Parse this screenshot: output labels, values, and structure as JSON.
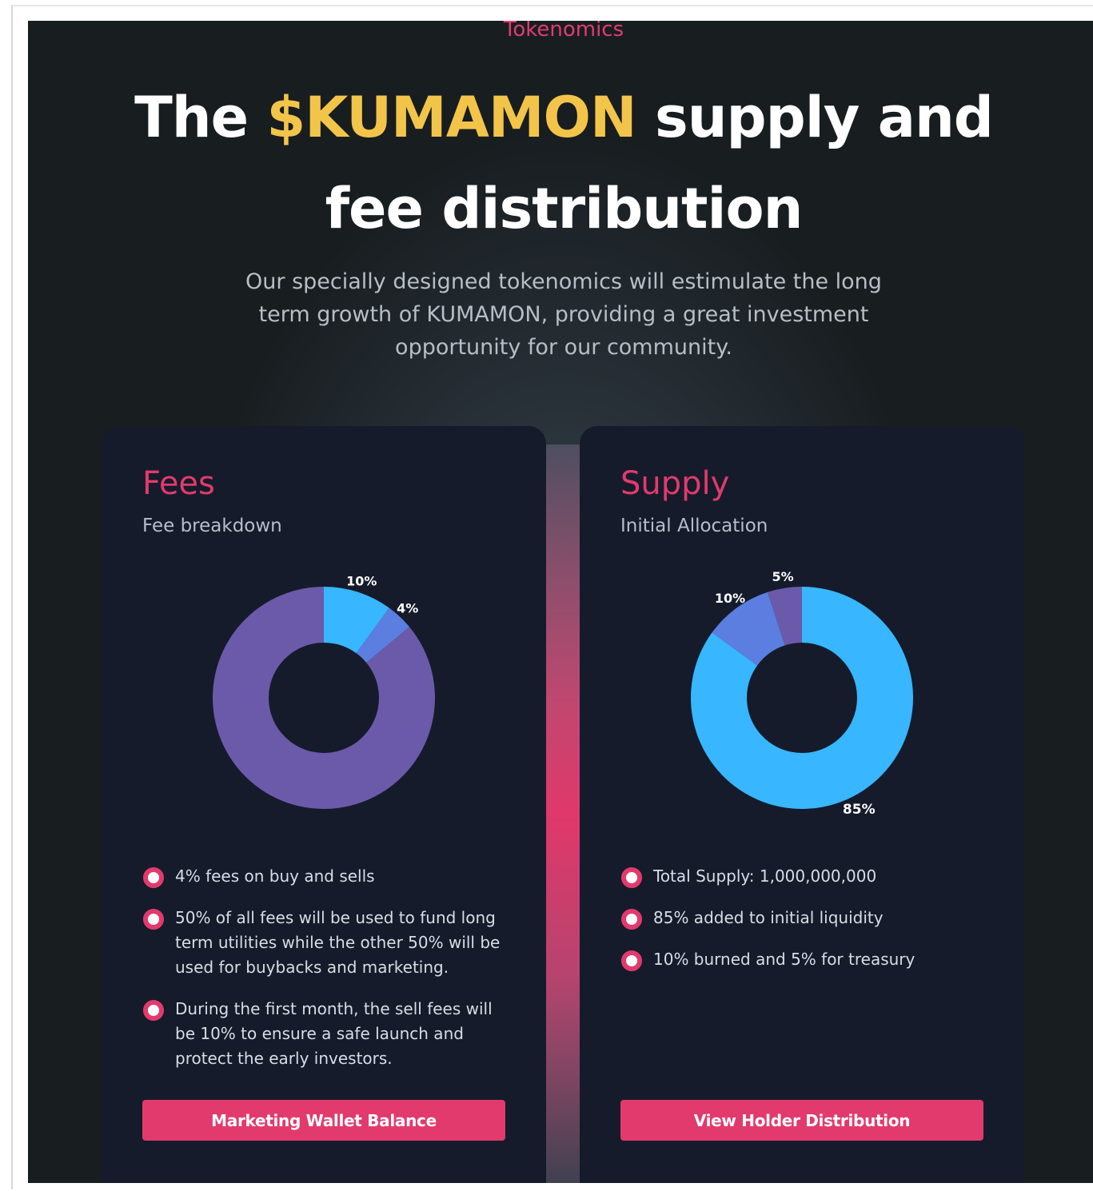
{
  "section": {
    "eyebrow": "Tokenomics",
    "headline": {
      "part1": "The ",
      "accent": "$KUMAMON",
      "part2": " supply and fee distribution"
    },
    "intro": "Our specially designed tokenomics will estimulate the long term growth of KUMAMON, providing a great investment opportunity for our community."
  },
  "colors": {
    "background": "#181d20",
    "card": "#151b2b",
    "accent_pink": "#e23a6c",
    "accent_gold": "#f2c44a",
    "donut_blue": "#38b6ff",
    "donut_indigo": "#5b7ee0",
    "donut_purple": "#6b5aa9"
  },
  "fees_card": {
    "title": "Fees",
    "subtitle": "Fee breakdown",
    "bullets": [
      "4% fees on buy and sells",
      "50% of all fees will be used to fund long term utilities while the other 50% will be used for buybacks and marketing.",
      "During the first month, the sell fees will be 10% to ensure a safe launch and protect the early investors."
    ],
    "button": "Marketing Wallet Balance"
  },
  "supply_card": {
    "title": "Supply",
    "subtitle": "Initial Allocation",
    "bullets": [
      "Total Supply: 1,000,000,000",
      "85% added to initial liquidity",
      "10% burned and 5% for treasury"
    ],
    "button": "View Holder Distribution"
  },
  "chart_data": [
    {
      "type": "pie",
      "title": "",
      "donut": true,
      "slices": [
        {
          "label": "10%",
          "value": 10,
          "color": "#38b6ff"
        },
        {
          "label": "4%",
          "value": 4,
          "color": "#5b7ee0"
        },
        {
          "label": "",
          "value": 86,
          "color": "#6b5aa9"
        }
      ]
    },
    {
      "type": "pie",
      "title": "",
      "donut": true,
      "slices": [
        {
          "label": "85%",
          "value": 85,
          "color": "#38b6ff"
        },
        {
          "label": "10%",
          "value": 10,
          "color": "#5b7ee0"
        },
        {
          "label": "5%",
          "value": 5,
          "color": "#6b5aa9"
        }
      ]
    }
  ]
}
